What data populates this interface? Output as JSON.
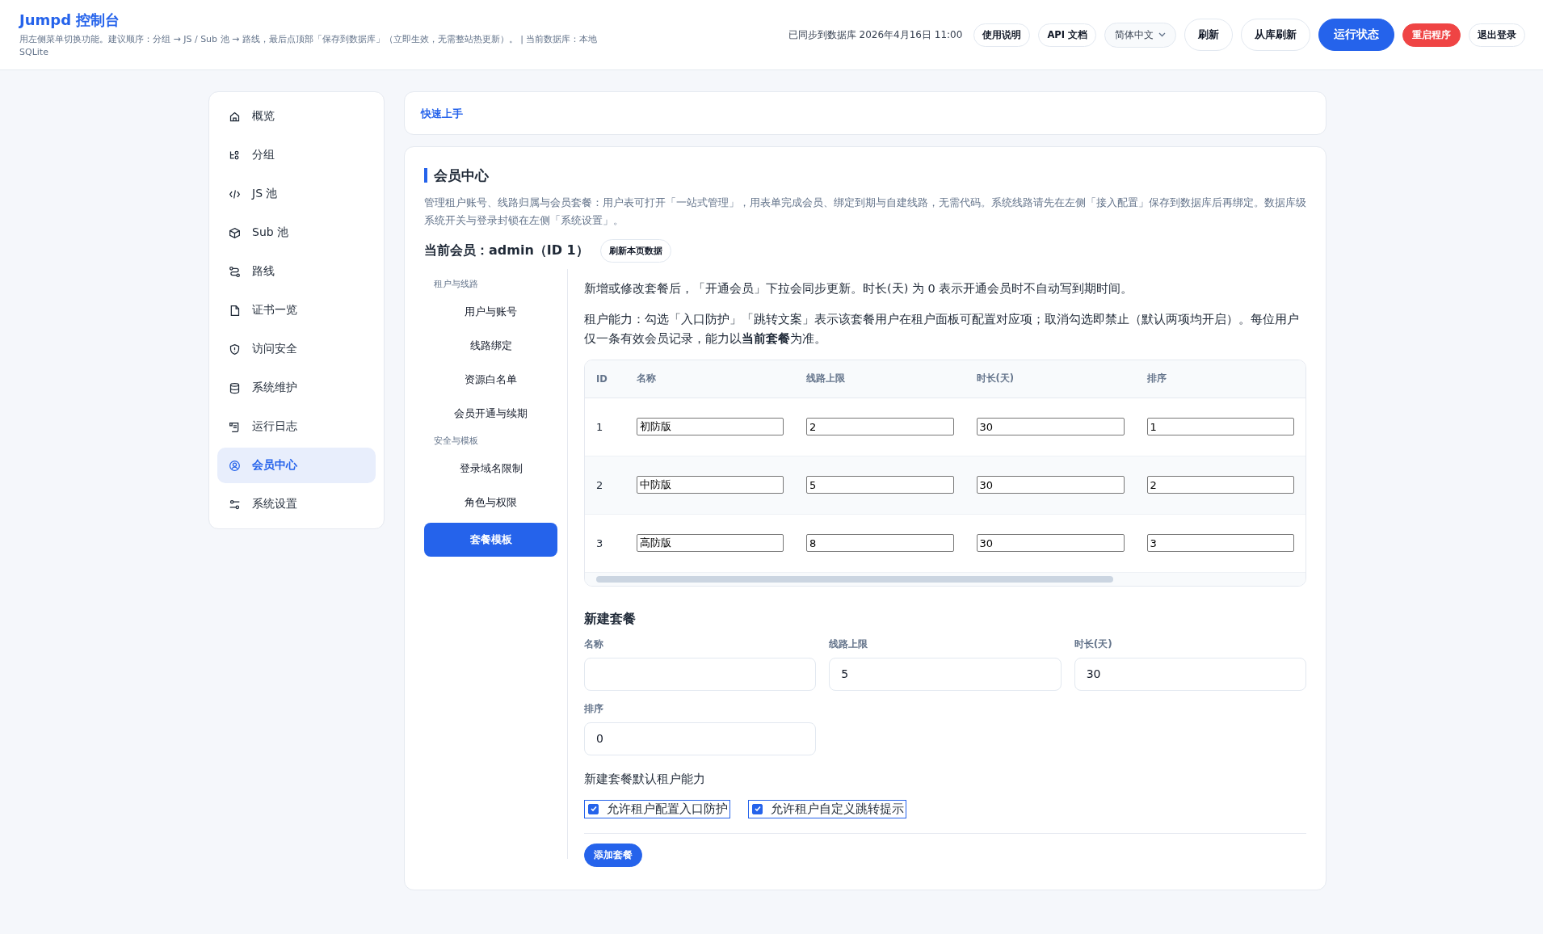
{
  "header": {
    "title": "Jumpd 控制台",
    "subtitle": "用左侧菜单切换功能。建议顺序：分组 → JS / Sub 池 → 路线，最后点顶部「保存到数据库」（立即生效，无需整站热更新）。 | 当前数据库：本地 SQLite",
    "sync_status": "已同步到数据库 2026年4月16日 11:00",
    "actions": [
      {
        "label": "使用说明",
        "kind": "small"
      },
      {
        "label": "API 文档",
        "kind": "small"
      },
      {
        "label": "简体中文",
        "kind": "select"
      },
      {
        "label": "刷新",
        "kind": "large"
      },
      {
        "label": "从库刷新",
        "kind": "large"
      },
      {
        "label": "运行状态",
        "kind": "primary"
      },
      {
        "label": "重启程序",
        "kind": "danger"
      },
      {
        "label": "退出登录",
        "kind": "small"
      }
    ]
  },
  "sidebar": {
    "items": [
      {
        "label": "概览",
        "selected": false
      },
      {
        "label": "分组",
        "selected": false
      },
      {
        "label": "JS 池",
        "selected": false
      },
      {
        "label": "Sub 池",
        "selected": false
      },
      {
        "label": "路线",
        "selected": false
      },
      {
        "label": "证书一览",
        "selected": false
      },
      {
        "label": "访问安全",
        "selected": false
      },
      {
        "label": "系统维护",
        "selected": false
      },
      {
        "label": "运行日志",
        "selected": false
      },
      {
        "label": "会员中心",
        "selected": true
      },
      {
        "label": "系统设置",
        "selected": false
      }
    ]
  },
  "quick_start": {
    "link": "快速上手"
  },
  "member_center": {
    "title": "会员中心",
    "description": "管理租户账号、线路归属与会员套餐：用户表可打开「一站式管理」，用表单完成会员、绑定到期与自建线路，无需代码。系统线路请先在左侧「接入配置」保存到数据库后再绑定。数据库级系统开关与登录封锁在左侧「系统设置」。",
    "current_member": "当前会员：admin（ID 1）",
    "refresh_button": "刷新本页数据",
    "subnav": [
      {
        "kind": "heading",
        "label": "租户与线路"
      },
      {
        "kind": "item",
        "label": "用户与账号",
        "selected": false
      },
      {
        "kind": "item",
        "label": "线路绑定",
        "selected": false
      },
      {
        "kind": "item",
        "label": "资源白名单",
        "selected": false
      },
      {
        "kind": "item",
        "label": "会员开通与续期",
        "selected": false
      },
      {
        "kind": "heading",
        "label": "安全与模板"
      },
      {
        "kind": "item",
        "label": "登录域名限制",
        "selected": false
      },
      {
        "kind": "item",
        "label": "角色与权限",
        "selected": false
      },
      {
        "kind": "item",
        "label": "套餐模板",
        "selected": true
      }
    ],
    "notes": [
      "新增或修改套餐后，「开通会员」下拉会同步更新。时长(天) 为 0 表示开通会员时不自动写到期时间。",
      "租户能力：勾选「入口防护」「跳转文案」表示该套餐用户在租户面板可配置对应项；取消勾选即禁止（默认两项均开启）。每位用户仅一条有效会员记录，能力以**当前套餐**为准。"
    ],
    "plans_table": {
      "columns": [
        "ID",
        "名称",
        "线路上限",
        "时长(天)",
        "排序"
      ],
      "rows": [
        [
          "1",
          "初防版",
          "2",
          "30",
          "1"
        ],
        [
          "2",
          "中防版",
          "5",
          "30",
          "2"
        ],
        [
          "3",
          "高防版",
          "8",
          "30",
          "3"
        ]
      ]
    },
    "new_plan": {
      "title": "新建套餐",
      "fields": [
        {
          "label": "名称"
        },
        {
          "label": "线路上限",
          "value": "5"
        },
        {
          "label": "时长(天)",
          "value": "30"
        },
        {
          "label": "排序",
          "value": "0"
        }
      ],
      "capabilities_title": "新建套餐默认租户能力",
      "capabilities": [
        {
          "label": "允许租户配置入口防护",
          "checked": true
        },
        {
          "label": "允许租户自定义跳转提示",
          "checked": true
        }
      ],
      "submit": "添加套餐"
    }
  }
}
